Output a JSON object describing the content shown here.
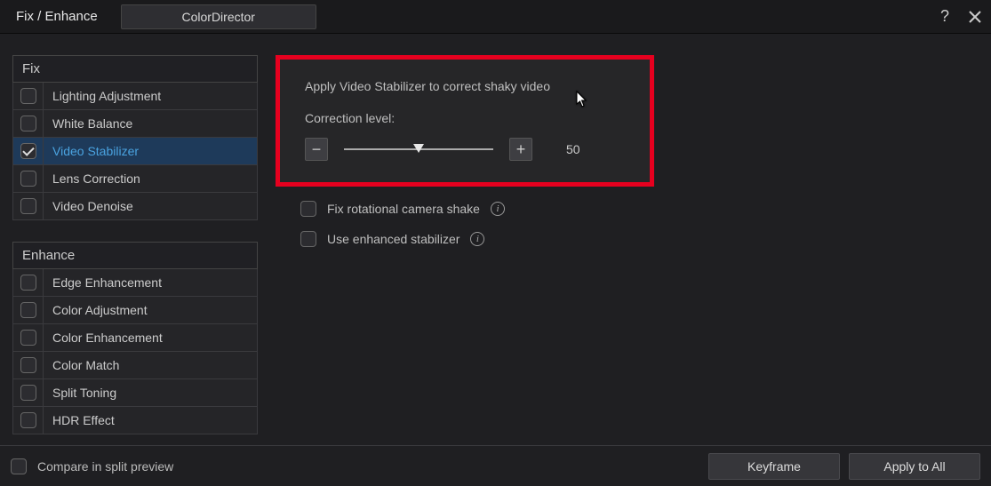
{
  "titlebar": {
    "title": "Fix / Enhance",
    "tab": "ColorDirector"
  },
  "sections": {
    "fix": {
      "header": "Fix",
      "items": [
        {
          "label": "Lighting Adjustment",
          "checked": false,
          "selected": false
        },
        {
          "label": "White Balance",
          "checked": false,
          "selected": false
        },
        {
          "label": "Video Stabilizer",
          "checked": true,
          "selected": true
        },
        {
          "label": "Lens Correction",
          "checked": false,
          "selected": false
        },
        {
          "label": "Video Denoise",
          "checked": false,
          "selected": false
        }
      ]
    },
    "enhance": {
      "header": "Enhance",
      "items": [
        {
          "label": "Edge Enhancement",
          "checked": false
        },
        {
          "label": "Color Adjustment",
          "checked": false
        },
        {
          "label": "Color Enhancement",
          "checked": false
        },
        {
          "label": "Color Match",
          "checked": false
        },
        {
          "label": "Split Toning",
          "checked": false
        },
        {
          "label": "HDR Effect",
          "checked": false
        }
      ]
    }
  },
  "panel": {
    "description": "Apply Video Stabilizer to correct shaky video",
    "level_label": "Correction level:",
    "value": "50",
    "opt_rotational": "Fix rotational camera shake",
    "opt_enhanced": "Use enhanced stabilizer"
  },
  "footer": {
    "compare": "Compare in split preview",
    "keyframe": "Keyframe",
    "apply_all": "Apply to All"
  }
}
